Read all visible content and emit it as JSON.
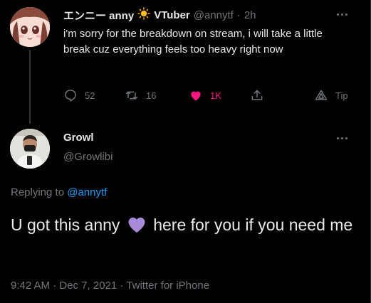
{
  "original_tweet": {
    "author_name": "エンニー anny",
    "author_suffix": "VTuber",
    "handle": "@annytf",
    "separator": "·",
    "time": "2h",
    "text": "i'm sorry for the breakdown on stream, i will take a little break cuz everything feels too heavy right now",
    "actions": {
      "replies": "52",
      "retweets": "16",
      "likes": "1K",
      "tip_label": "Tip"
    }
  },
  "reply_tweet": {
    "author_name": "Growl",
    "handle": "@Growlibi",
    "replying_prefix": "Replying to",
    "replying_handle": "@annytf",
    "text_before_emoji": "U got this anny",
    "text_after_emoji": "here for you if you need me",
    "timestamp": "9:42 AM · Dec 7, 2021 · Twitter for iPhone"
  },
  "colors": {
    "background": "#000000",
    "text": "#e7e9ea",
    "muted": "#71767b",
    "link": "#1d9bf0",
    "like": "#f91880",
    "heart_emoji": "#a78bd8"
  },
  "icons": [
    "sun-emoji-icon",
    "more-icon",
    "reply-icon",
    "retweet-icon",
    "like-icon",
    "share-icon",
    "tip-icon",
    "purple-heart-emoji-icon"
  ]
}
